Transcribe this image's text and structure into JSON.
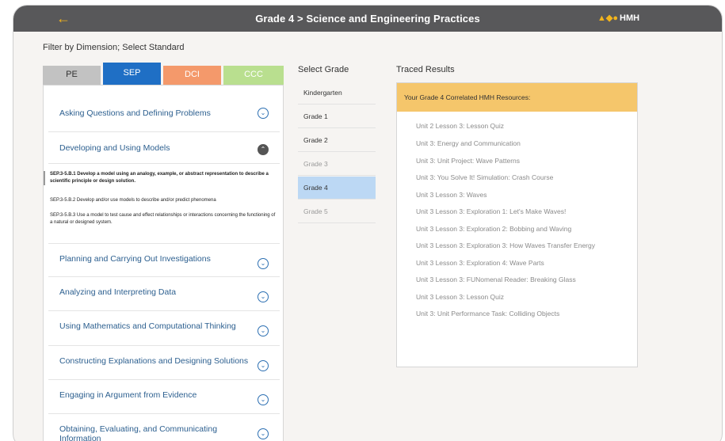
{
  "header": {
    "title": "Grade 4 > Science and Engineering Practices",
    "back_icon": "arrow-left-icon",
    "logo_text": "HMH",
    "logo_mark": "▲◆●"
  },
  "filter_label": "Filter by Dimension; Select Standard",
  "tabs": [
    {
      "label": "PE"
    },
    {
      "label": "SEP"
    },
    {
      "label": "DCI"
    },
    {
      "label": "CCC"
    }
  ],
  "active_tab": "SEP",
  "practices": [
    {
      "label": "Asking Questions and Defining Problems",
      "icon": "chevron-down-icon"
    },
    {
      "label": "Developing and Using Models",
      "icon": "chevron-up-icon"
    },
    {
      "label": "Planning and Carrying Out Investigations",
      "icon": "chevron-down-icon"
    },
    {
      "label": "Analyzing and Interpreting Data",
      "icon": "chevron-down-icon"
    },
    {
      "label": "Using Mathematics and Computational Thinking",
      "icon": "chevron-down-icon"
    },
    {
      "label": "Constructing Explanations and Designing Solutions",
      "icon": "chevron-down-icon"
    },
    {
      "label": "Engaging in Argument from Evidence",
      "icon": "chevron-down-icon"
    },
    {
      "label": "Obtaining, Evaluating, and Communicating Information",
      "icon": "chevron-down-icon"
    }
  ],
  "standards": [
    "SEP.3-5.B.1 Develop a model using an analogy, example, or abstract representation to describe a scientific principle or design solution.",
    "SEP.3-5.B.2 Develop and/or use models to describe and/or predict phenomena",
    "SEP.3-5.B.3 Use a model to test cause and effect relationships or interactions concerning the functioning of a natural or designed system."
  ],
  "grade_heading": "Select Grade",
  "grades": [
    {
      "label": "Kindergarten"
    },
    {
      "label": "Grade 1"
    },
    {
      "label": "Grade 2"
    },
    {
      "label": "Grade 3"
    },
    {
      "label": "Grade 4"
    },
    {
      "label": "Grade 5"
    }
  ],
  "selected_grade": "Grade 4",
  "results_heading": "Traced Results",
  "results_header": "Your Grade 4 Correlated HMH Resources:",
  "results": [
    "Unit 2 Lesson 3: Lesson Quiz",
    "Unit 3: Energy and Communication",
    "Unit 3: Unit Project: Wave Patterns",
    "Unit 3: You Solve It! Simulation: Crash Course",
    "Unit 3 Lesson 3: Waves",
    "Unit 3 Lesson 3: Exploration 1: Let's Make Waves!",
    "Unit 3 Lesson 3: Exploration 2: Bobbing and Waving",
    "Unit 3 Lesson 3: Exploration 3: How Waves Transfer Energy",
    "Unit 3 Lesson 3: Exploration 4: Wave Parts",
    "Unit 3 Lesson 3: FUNomenal Reader: Breaking Glass",
    "Unit 3 Lesson 3: Lesson Quiz",
    "Unit 3: Unit Performance Task: Colliding Objects"
  ],
  "colors": {
    "topbar": "#58585a",
    "accent": "#f2b41c",
    "tab_pe": "#c2c2c2",
    "tab_sep": "#1f6fc5",
    "tab_dci": "#f4996b",
    "tab_ccc": "#b9df8f",
    "results_header": "#f5c66b",
    "selected_grade": "#bcd8f4"
  }
}
